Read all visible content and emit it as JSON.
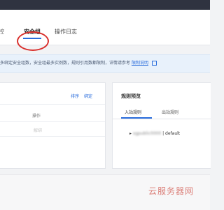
{
  "tabs": {
    "partial_label": "控",
    "security_group": "安全组",
    "operation_log": "操作日志"
  },
  "notice": {
    "text": "多绑定安全组数，安全组最多实例数，规则引用数都限制，详情请参考",
    "link": "限制说明"
  },
  "left_panel": {
    "sort": "排序",
    "settings": "绑定",
    "header_operation": "操作",
    "row_action": "解绑"
  },
  "right_panel": {
    "title": "规则预览",
    "tab_inbound": "入站规则",
    "tab_outbound": "出站规则",
    "rule_blurred": "sgpublic0000",
    "rule_suffix": " | default"
  },
  "watermark": "云服务器网"
}
